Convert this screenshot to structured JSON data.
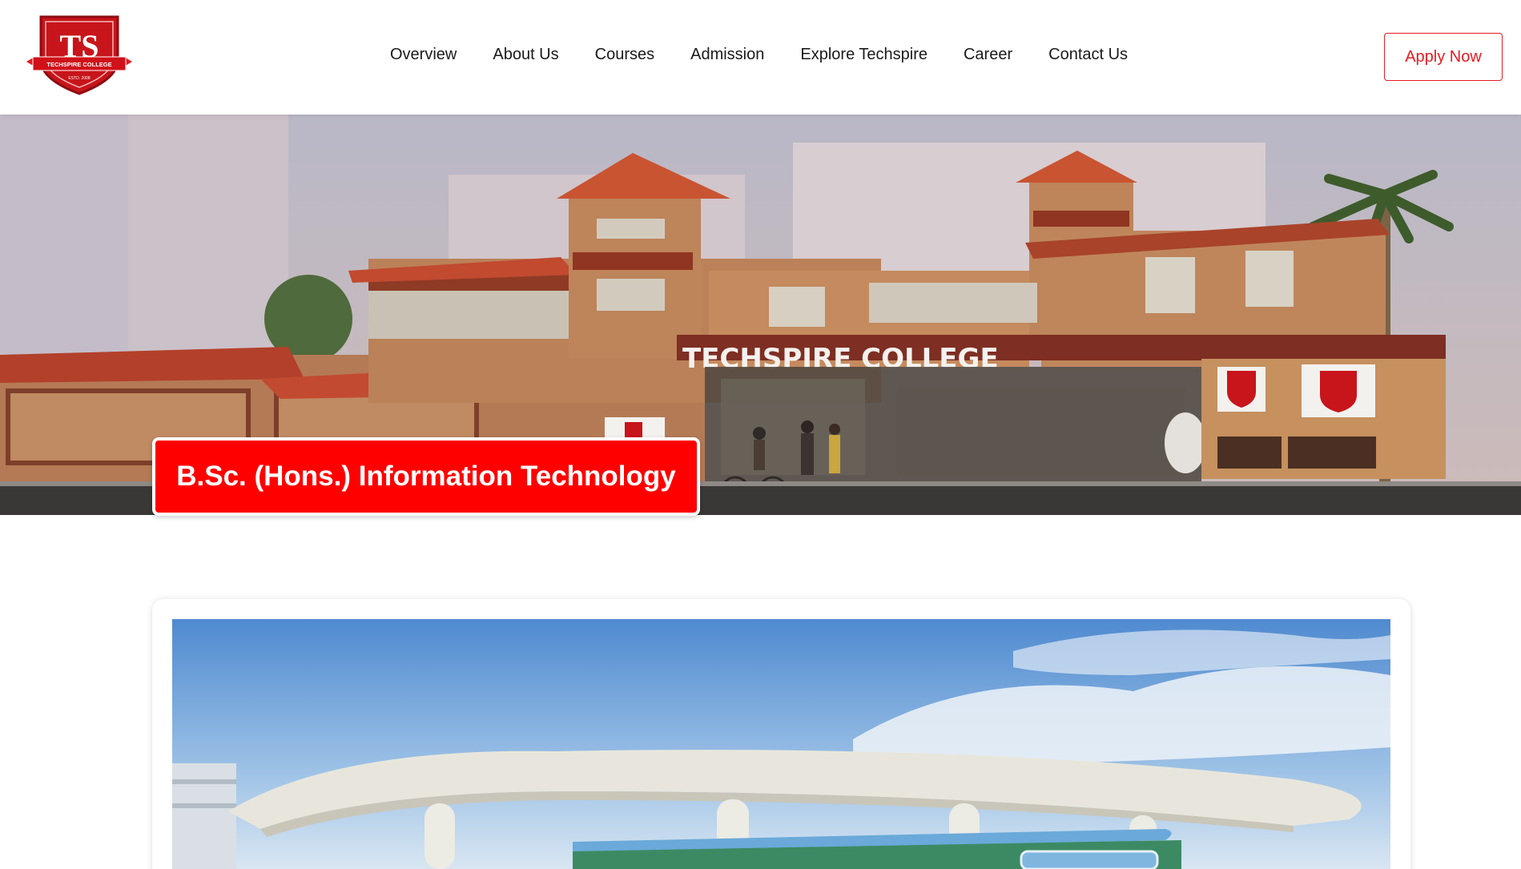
{
  "brand": {
    "logo_monogram": "TS",
    "logo_banner_text": "TECHSPIRE COLLEGE",
    "logo_estd": "ESTD. 2008"
  },
  "nav": {
    "items": [
      {
        "label": "Overview"
      },
      {
        "label": "About Us"
      },
      {
        "label": "Courses"
      },
      {
        "label": "Admission"
      },
      {
        "label": "Explore Techspire"
      },
      {
        "label": "Career"
      },
      {
        "label": "Contact Us"
      }
    ],
    "apply_label": "Apply Now"
  },
  "hero": {
    "building_sign": "TECHSPIRE   COLLEGE",
    "course_title": "B.Sc. (Hons.) Information Technology"
  },
  "colors": {
    "brand_red": "#e51b23",
    "title_red": "#ff0000"
  },
  "icons": [
    "college-logo-shield"
  ]
}
